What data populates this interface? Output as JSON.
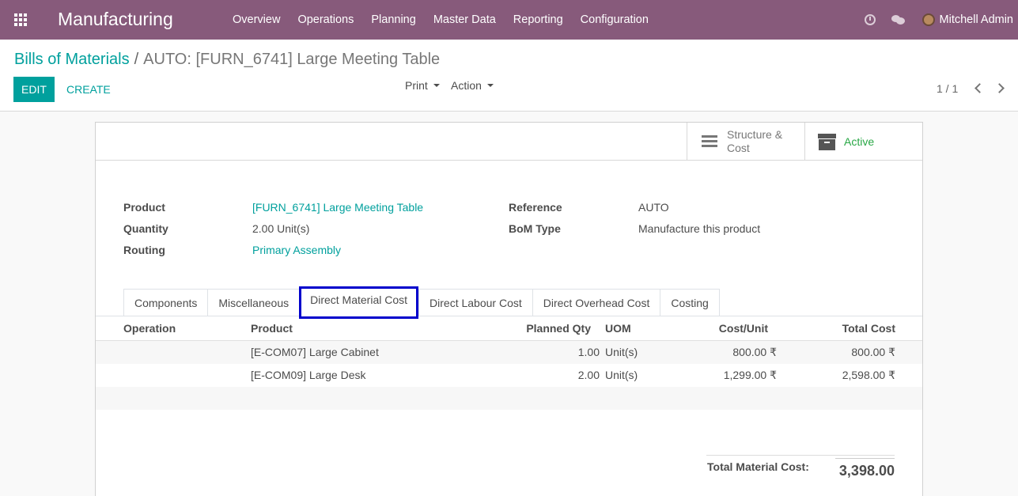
{
  "navbar": {
    "app_name": "Manufacturing",
    "menu": [
      "Overview",
      "Operations",
      "Planning",
      "Master Data",
      "Reporting",
      "Configuration"
    ],
    "user": "Mitchell Admin",
    "color": "#875a7b"
  },
  "breadcrumb": {
    "parent": "Bills of Materials",
    "separator": "/",
    "current": "AUTO: [FURN_6741] Large Meeting Table"
  },
  "toolbar": {
    "edit_label": "EDIT",
    "create_label": "CREATE",
    "print_label": "Print",
    "action_label": "Action",
    "pager": "1 / 1"
  },
  "stat_buttons": {
    "structure_label": "Structure & Cost",
    "active_label": "Active"
  },
  "fields": {
    "product_label": "Product",
    "product_value": "[FURN_6741] Large Meeting Table",
    "quantity_label": "Quantity",
    "quantity_value": "2.00",
    "quantity_uom": "Unit(s)",
    "routing_label": "Routing",
    "routing_value": "Primary Assembly",
    "reference_label": "Reference",
    "reference_value": "AUTO",
    "bom_type_label": "BoM Type",
    "bom_type_value": "Manufacture this product"
  },
  "tabs": [
    "Components",
    "Miscellaneous",
    "Direct Material Cost",
    "Direct Labour Cost",
    "Direct Overhead Cost",
    "Costing"
  ],
  "active_tab": "Direct Material Cost",
  "table": {
    "headers": {
      "operation": "Operation",
      "product": "Product",
      "planned_qty": "Planned Qty",
      "uom": "UOM",
      "cost_unit": "Cost/Unit",
      "total_cost": "Total Cost"
    },
    "rows": [
      {
        "operation": "",
        "product": "[E-COM07] Large Cabinet",
        "planned_qty": "1.00",
        "uom": "Unit(s)",
        "cost_unit": "800.00 ₹",
        "total_cost": "800.00 ₹"
      },
      {
        "operation": "",
        "product": "[E-COM09] Large Desk",
        "planned_qty": "2.00",
        "uom": "Unit(s)",
        "cost_unit": "1,299.00 ₹",
        "total_cost": "2,598.00 ₹"
      }
    ]
  },
  "total": {
    "label": "Total Material Cost:",
    "value": "3,398.00"
  },
  "colors": {
    "accent": "#00a09d",
    "active": "#28a745",
    "highlight": "#0000cc"
  }
}
